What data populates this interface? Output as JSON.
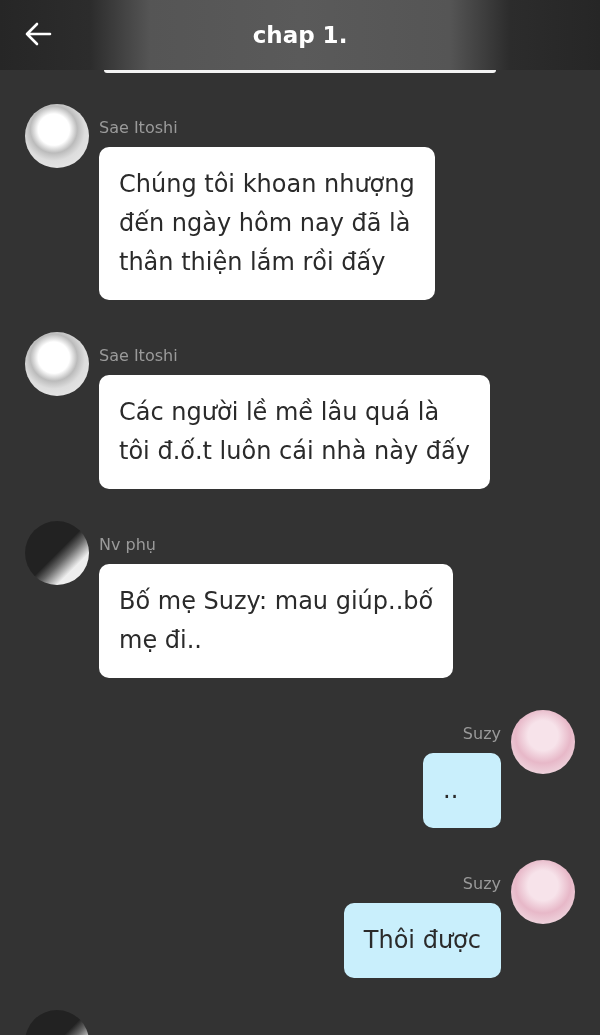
{
  "header": {
    "title": "chap 1."
  },
  "messages": [
    {
      "kind": "received",
      "avatar": {
        "kind": "sketch"
      },
      "name": "Sae Itoshi",
      "lines": [
        "Chúng tôi khoan nhượng",
        "đến ngày hôm nay đã là",
        "thân thiện lắm rồi đấy"
      ]
    },
    {
      "kind": "received",
      "avatar": {
        "kind": "sketch"
      },
      "name": "Sae Itoshi",
      "lines": [
        "Các người lề mề lâu quá là",
        "tôi đ.ố.t luôn cái nhà này đấy"
      ]
    },
    {
      "kind": "received",
      "avatar": {
        "kind": "dark"
      },
      "name": "Nv phụ",
      "lines": [
        "Bố mẹ Suzy: mau giúp..bố",
        "mẹ đi.."
      ]
    },
    {
      "kind": "sent",
      "avatar": {
        "kind": "pink"
      },
      "name": "Suzy",
      "lines": [
        ".."
      ]
    },
    {
      "kind": "sent",
      "avatar": {
        "kind": "pink"
      },
      "name": "Suzy",
      "lines": [
        "Thôi được"
      ]
    },
    {
      "kind": "received",
      "avatar": {
        "kind": "dark"
      }
    }
  ]
}
